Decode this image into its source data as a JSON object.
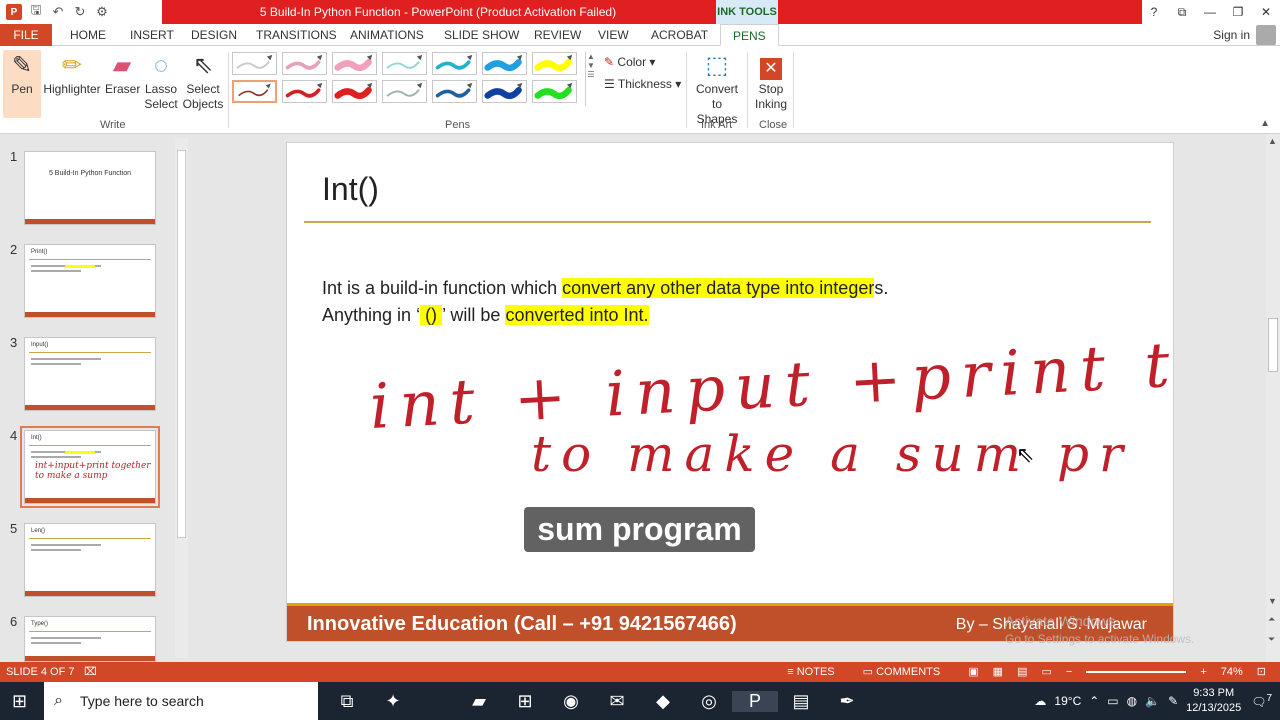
{
  "window": {
    "title": "5 Build-In Python Function - PowerPoint (Product Activation Failed)",
    "contextual_tab": "INK TOOLS",
    "controls": [
      "?",
      "⧉",
      "—",
      "❐",
      "✕"
    ]
  },
  "qat": {
    "icons": [
      "save-icon",
      "undo-icon",
      "redo-icon",
      "customize-icon"
    ]
  },
  "tabs": [
    "FILE",
    "HOME",
    "INSERT",
    "DESIGN",
    "TRANSITIONS",
    "ANIMATIONS",
    "SLIDE SHOW",
    "REVIEW",
    "VIEW",
    "ACROBAT",
    "PENS"
  ],
  "signin": "Sign in",
  "ribbon": {
    "write": {
      "pen": "Pen",
      "highlighter": "Highlighter",
      "eraser": "Eraser",
      "lasso_1": "Lasso",
      "lasso_2": "Select",
      "select_1": "Select",
      "select_2": "Objects",
      "group": "Write"
    },
    "pens_group": "Pens",
    "color": "Color",
    "thickness": "Thickness",
    "convert_1": "Convert",
    "convert_2": "to Shapes",
    "ink_art": "Ink Art",
    "stop_1": "Stop",
    "stop_2": "Inking",
    "close": "Close"
  },
  "pens": [
    {
      "color": "#c8c8c8"
    },
    {
      "color": "#e8a0b8"
    },
    {
      "color": "#f0a0b8"
    },
    {
      "color": "#90d8d8"
    },
    {
      "color": "#20b0d0"
    },
    {
      "color": "#20a0e0"
    },
    {
      "color": "#ffff00"
    },
    {
      "color": "#8b3a2a"
    },
    {
      "color": "#d02020"
    },
    {
      "color": "#e02020"
    },
    {
      "color": "#a0b0b0"
    },
    {
      "color": "#2060a0"
    },
    {
      "color": "#1040a0"
    },
    {
      "color": "#20e020"
    }
  ],
  "thumbnails": [
    {
      "num": "1",
      "title": "5 Build-In Python Function",
      "head": ""
    },
    {
      "num": "2",
      "title": "",
      "head": "Print()"
    },
    {
      "num": "3",
      "title": "",
      "head": "Input()"
    },
    {
      "num": "4",
      "title": "",
      "head": "Int()",
      "ink": "int+input+print together to make a sump"
    },
    {
      "num": "5",
      "title": "",
      "head": "Len()"
    },
    {
      "num": "6",
      "title": "",
      "head": "Type()"
    }
  ],
  "slide": {
    "title": "Int()",
    "line1_a": "Int is a build-in function which ",
    "line1_hl": "convert any other data type into integer",
    "line1_b": "s.",
    "line2_a": "Anything in ",
    "line2_q1": "‘",
    "line2_hl1": " () ",
    "line2_q2": "’",
    "line2_b": " will be ",
    "line2_hl2": "converted into Int.",
    "footer_left": "Innovative Education (Call – +91 9421567466)",
    "footer_right": "By – Shayanali S. Mujawar",
    "ink_line1": "int + input +print together",
    "ink_line2": "to make a sum pr"
  },
  "caption": "sum program",
  "activate": {
    "line1": "Activate Windows",
    "line2": "Go to Settings to activate Windows."
  },
  "status": {
    "slide": "SLIDE 4 OF 7",
    "notes": "NOTES",
    "comments": "COMMENTS",
    "zoom": "74%"
  },
  "taskbar": {
    "search_placeholder": "Type here to search",
    "weather": "19°C",
    "time": "9:33 PM",
    "date": "12/13/2025",
    "notif": "7"
  }
}
